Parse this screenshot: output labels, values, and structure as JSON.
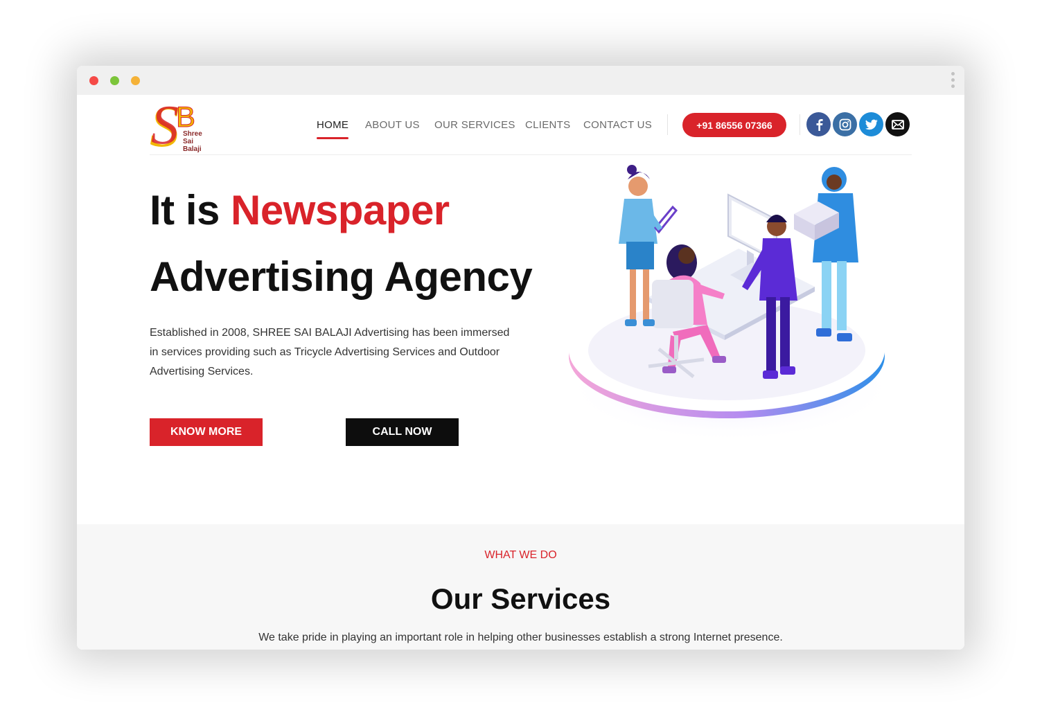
{
  "browser": {
    "controls": [
      "close",
      "minimize",
      "maximize"
    ],
    "menu_icon": "kebab-menu-icon"
  },
  "header": {
    "logo": {
      "mark": "SB",
      "line1": "Shree",
      "line2": "Sai",
      "line3": "Balaji"
    },
    "nav": [
      {
        "label": "HOME",
        "active": true
      },
      {
        "label": "ABOUT US"
      },
      {
        "label": "OUR SERVICES"
      },
      {
        "label": "CLIENTS"
      },
      {
        "label": "CONTACT US"
      }
    ],
    "phone": "+91 86556 07366",
    "social": [
      {
        "icon": "facebook-icon",
        "color": "#3b5998"
      },
      {
        "icon": "instagram-icon",
        "color": "#3b6fa5"
      },
      {
        "icon": "twitter-icon",
        "color": "#1d8cd8"
      },
      {
        "icon": "email-icon",
        "color": "#111111"
      }
    ]
  },
  "hero": {
    "title_line1_prefix": "It is ",
    "title_line1_accent": "Newspaper",
    "title_line2": "Advertising Agency",
    "description": "Established in 2008, SHREE SAI BALAJI Advertising has been immersed in services providing such as Tricycle Advertising Services and Outdoor Advertising Services.",
    "primary_button": "KNOW MORE",
    "secondary_button": "CALL NOW"
  },
  "services": {
    "kicker": "WHAT WE DO",
    "title": "Our Services",
    "description": "We take pride in playing an important role in helping other businesses establish a strong Internet presence."
  },
  "colors": {
    "accent": "#d9232a",
    "dark": "#0d0d0d",
    "section_bg": "#f7f7f7"
  }
}
